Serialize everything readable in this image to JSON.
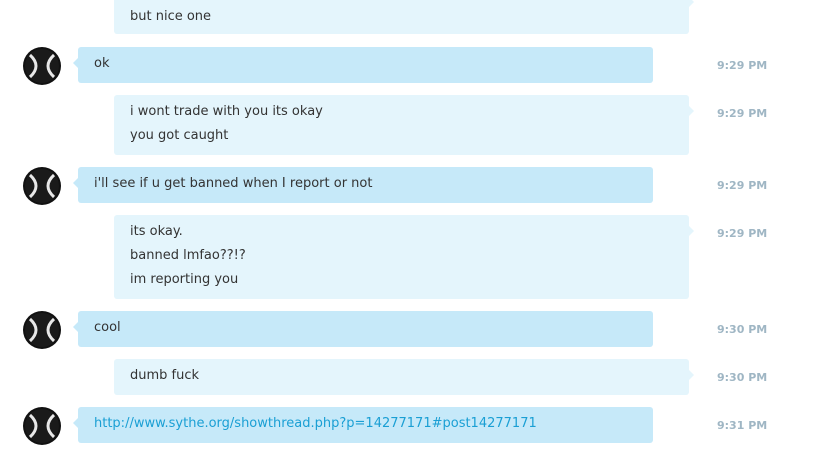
{
  "messages": [
    {
      "id": "m0",
      "direction": "outgoing",
      "lines": [
        "but nice one"
      ],
      "time": ""
    },
    {
      "id": "m1",
      "direction": "incoming",
      "lines": [
        "ok"
      ],
      "time": "9:29 PM"
    },
    {
      "id": "m2",
      "direction": "outgoing",
      "lines": [
        "i wont trade with you its okay",
        "you got caught"
      ],
      "time": "9:29 PM"
    },
    {
      "id": "m3",
      "direction": "incoming",
      "lines": [
        "i'll see if u get banned when I report or not"
      ],
      "time": "9:29 PM"
    },
    {
      "id": "m4",
      "direction": "outgoing",
      "lines": [
        "its okay.",
        "banned lmfao??!?",
        "im reporting you"
      ],
      "time": "9:29 PM"
    },
    {
      "id": "m5",
      "direction": "incoming",
      "lines": [
        "cool"
      ],
      "time": "9:30 PM"
    },
    {
      "id": "m6",
      "direction": "outgoing",
      "lines": [
        "dumb fuck"
      ],
      "time": "9:30 PM"
    },
    {
      "id": "m7",
      "direction": "incoming",
      "lines": [
        "http://www.sythe.org/showthread.php?p=14277171#post14277171"
      ],
      "time": "9:31 PM",
      "is_link": true
    }
  ],
  "colors": {
    "incoming_bubble": "#c6e9f9",
    "outgoing_bubble": "#e4f5fc",
    "timestamp": "#9fb6c4",
    "link": "#1a9fd4"
  },
  "icons": {
    "avatar": "contact-avatar-icon"
  }
}
